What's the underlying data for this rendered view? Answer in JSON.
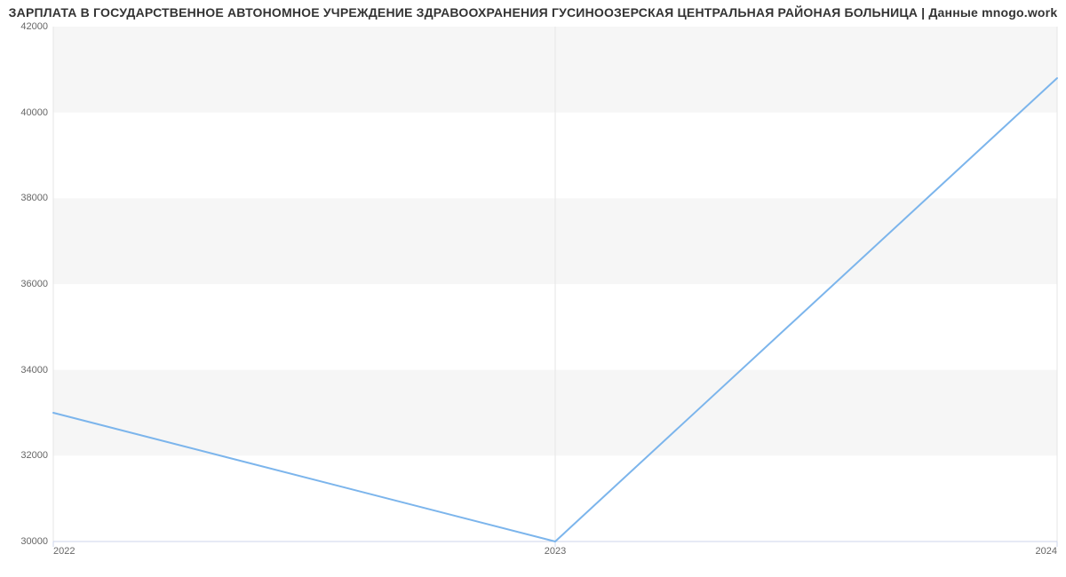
{
  "chart_data": {
    "type": "line",
    "title": "ЗАРПЛАТА В ГОСУДАРСТВЕННОЕ АВТОНОМНОЕ УЧРЕЖДЕНИЕ ЗДРАВООХРАНЕНИЯ ГУСИНООЗЕРСКАЯ ЦЕНТРАЛЬНАЯ РАЙОНАЯ БОЛЬНИЦА | Данные mnogo.work",
    "x": [
      2022,
      2023,
      2024
    ],
    "values": [
      33000,
      30000,
      40800
    ],
    "xlabel": "",
    "ylabel": "",
    "xlim": [
      2022,
      2024
    ],
    "ylim": [
      30000,
      42000
    ],
    "y_ticks": [
      30000,
      32000,
      34000,
      36000,
      38000,
      40000,
      42000
    ],
    "x_ticks": [
      2022,
      2023,
      2024
    ],
    "line_color": "#7cb5ec",
    "band_color": "#f7f7f7"
  }
}
